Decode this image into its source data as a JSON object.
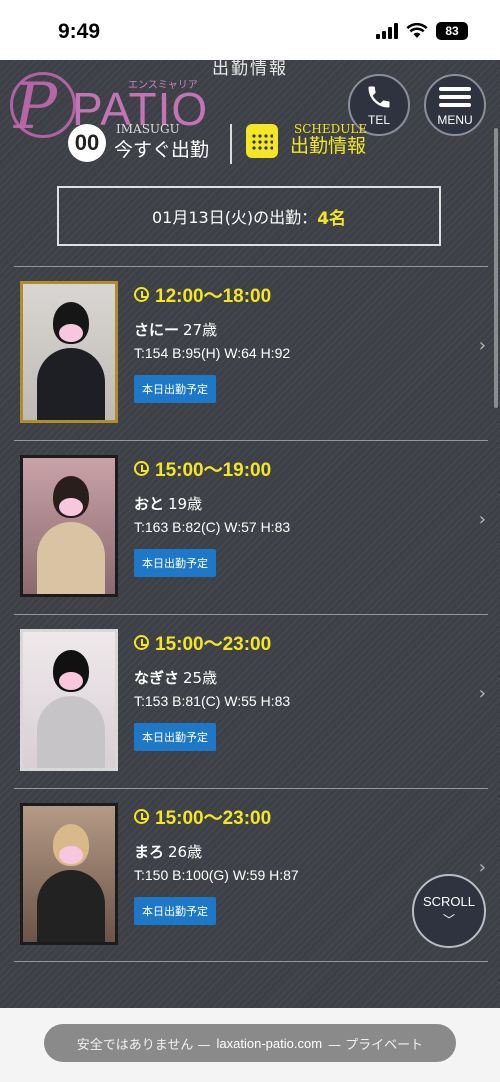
{
  "status_bar": {
    "time": "9:49",
    "battery": "83"
  },
  "header": {
    "section_title": "出勤情報",
    "logo": {
      "word": "PATIO",
      "subtitle": "エンスミャリア"
    },
    "tel_label": "TEL",
    "menu_label": "MENU"
  },
  "tabs": {
    "now": {
      "badge": "00",
      "en": "IMASUGU",
      "jp": "今すぐ出勤"
    },
    "schedule": {
      "en": "SCHEDULE",
      "jp": "出勤情報"
    }
  },
  "date_summary": {
    "text": "01月13日(火)の出勤：",
    "count": "4名"
  },
  "staff": [
    {
      "time": "12:00〜18:00",
      "name": "さにー",
      "age": "27歳",
      "stats": "T:154 B:95(H) W:64 H:92",
      "tag": "本日出勤予定"
    },
    {
      "time": "15:00〜19:00",
      "name": "おと",
      "age": "19歳",
      "stats": "T:163 B:82(C) W:57 H:83",
      "tag": "本日出勤予定"
    },
    {
      "time": "15:00〜23:00",
      "name": "なぎさ",
      "age": "25歳",
      "stats": "T:153 B:81(C) W:55 H:83",
      "tag": "本日出勤予定"
    },
    {
      "time": "15:00〜23:00",
      "name": "まろ",
      "age": "26歳",
      "stats": "T:150 B:100(G) W:59 H:87",
      "tag": "本日出勤予定"
    }
  ],
  "scroll_button": {
    "label": "SCROLL",
    "arrow": "﹀"
  },
  "chevron": "›",
  "url_bar": {
    "prefix": "安全ではありません —",
    "domain": "laxation-patio.com",
    "suffix": "— プライベート"
  },
  "colors": {
    "accent_yellow": "#f3e624",
    "tag_blue": "#1e78c8",
    "background": "#3d4046"
  }
}
